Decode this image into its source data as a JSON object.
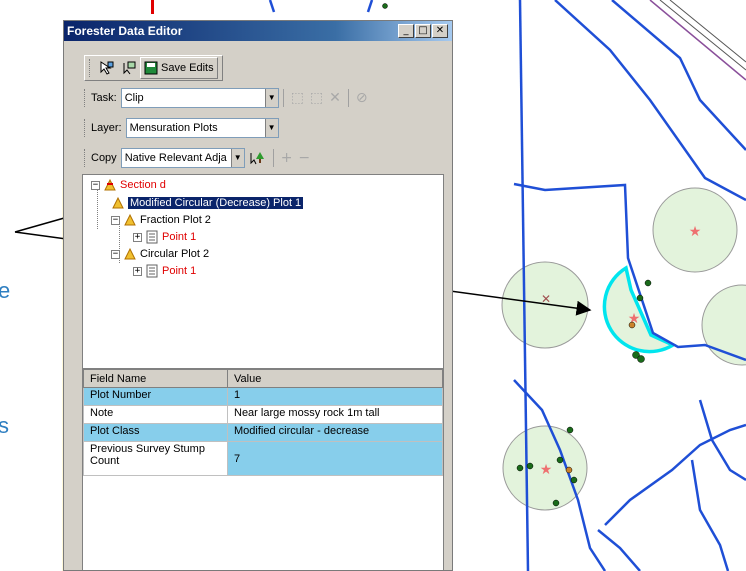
{
  "window": {
    "title": "Forester Data Editor"
  },
  "toolbar1": {
    "save_label": "Save Edits"
  },
  "task": {
    "label": "Task:",
    "value": "Clip"
  },
  "layer": {
    "label": "Layer:",
    "value": "Mensuration Plots"
  },
  "copy": {
    "label": "Copy",
    "value": "Native Relevant Adja"
  },
  "tree": {
    "section": "Section d",
    "selected": "Modified Circular (Decrease) Plot 1",
    "fraction_plot": "Fraction Plot 2",
    "fraction_point": "Point 1",
    "circular_plot": "Circular Plot 2",
    "circular_point": "Point 1"
  },
  "grid": {
    "headers": [
      "Field Name",
      "Value"
    ],
    "rows": [
      {
        "name": "Plot Number",
        "value": "1"
      },
      {
        "name": "Note",
        "value": "Near large mossy rock 1m tall"
      },
      {
        "name": "Plot Class",
        "value": "Modified circular - decrease"
      },
      {
        "name": "Previous Survey Stump Count",
        "value": "7"
      }
    ]
  },
  "side_letters": [
    "e",
    "s"
  ],
  "colors": {
    "title_bar": "#0a246a",
    "selection": "#0a246a",
    "grid_highlight": "#87ceeb",
    "boundary_blue": "#1f4fd6",
    "highlight_cyan": "#00e5ee",
    "plot_fill": "#e3f3dc",
    "tree_red": "#e00000"
  },
  "icons": [
    "select-feature-icon",
    "edit-tool-icon",
    "save-edits-icon",
    "sketch-icon",
    "delete-icon",
    "stop-icon",
    "tree-add-icon"
  ]
}
